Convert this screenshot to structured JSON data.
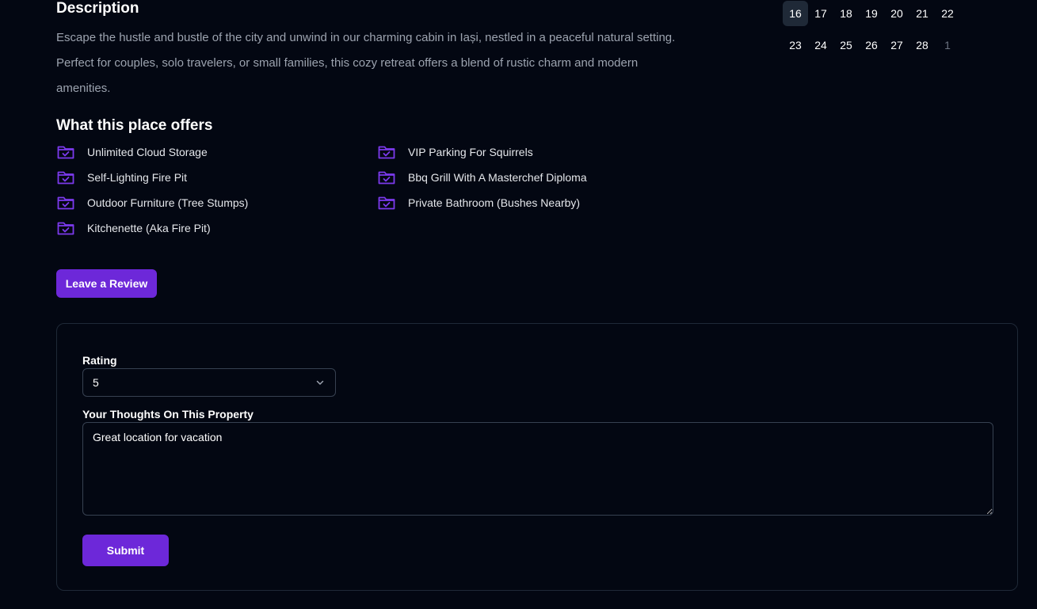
{
  "description": {
    "title": "Description",
    "text": "Escape the hustle and bustle of the city and unwind in our charming cabin in Iași, nestled in a peaceful natural setting. Perfect for couples, solo travelers, or small families, this cozy retreat offers a blend of rustic charm and modern amenities."
  },
  "offers": {
    "title": "What this place offers",
    "icon": "folder-check-icon",
    "icon_color": "#7c3aed",
    "items": [
      {
        "label": "Unlimited Cloud Storage"
      },
      {
        "label": "VIP Parking For Squirrels"
      },
      {
        "label": "Self-Lighting Fire Pit"
      },
      {
        "label": "Bbq Grill With A Masterchef Diploma"
      },
      {
        "label": "Outdoor Furniture (Tree Stumps)"
      },
      {
        "label": "Private Bathroom (Bushes Nearby)"
      },
      {
        "label": "Kitchenette (Aka Fire Pit)"
      }
    ]
  },
  "review_button": {
    "label": "Leave a Review"
  },
  "review_form": {
    "rating_label": "Rating",
    "rating_value": "5",
    "thoughts_label": "Your Thoughts On This Property",
    "thoughts_value": "Great location for vacation",
    "submit_label": "Submit"
  },
  "calendar": {
    "selected_day": "16",
    "weeks": [
      [
        "16",
        "17",
        "18",
        "19",
        "20",
        "21",
        "22"
      ],
      [
        "23",
        "24",
        "25",
        "26",
        "27",
        "28",
        "1"
      ]
    ],
    "outside_days": [
      "1"
    ]
  },
  "colors": {
    "background": "#030712",
    "accent": "#6d28d9",
    "muted_text": "#9ca3af",
    "border": "#1f2937"
  }
}
